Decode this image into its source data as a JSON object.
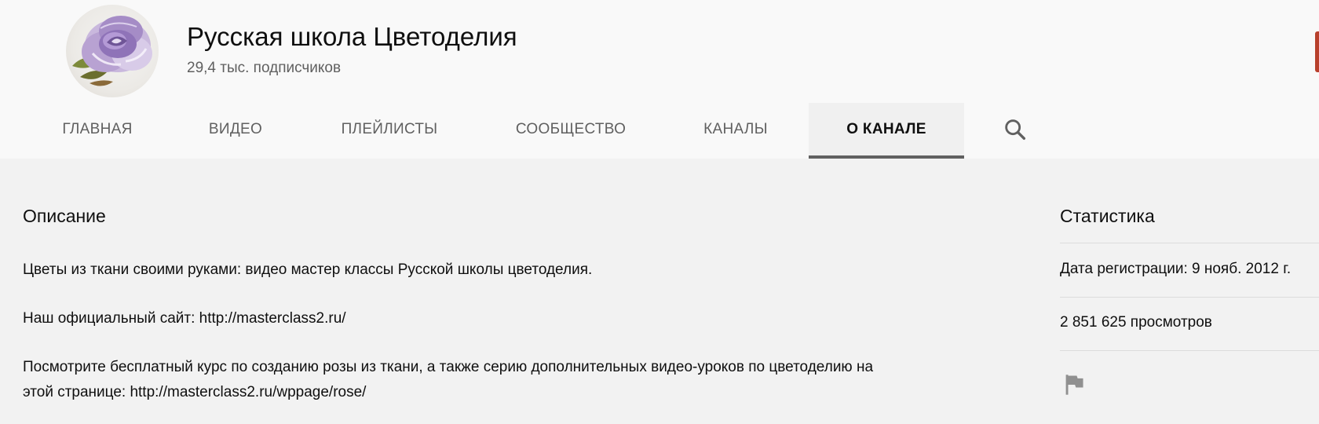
{
  "channel": {
    "title": "Русская школа Цветоделия",
    "subscribers": "29,4 тыс. подписчиков"
  },
  "tabs": [
    {
      "label": "ГЛАВНАЯ",
      "active": false
    },
    {
      "label": "ВИДЕО",
      "active": false
    },
    {
      "label": "ПЛЕЙЛИСТЫ",
      "active": false
    },
    {
      "label": "СООБЩЕСТВО",
      "active": false
    },
    {
      "label": "КАНАЛЫ",
      "active": false
    },
    {
      "label": "О КАНАЛЕ",
      "active": true
    }
  ],
  "icons": {
    "search": "search-icon",
    "flag": "flag-icon",
    "avatar": "rose-avatar"
  },
  "description": {
    "heading": "Описание",
    "paragraphs": [
      "Цветы из ткани своими руками: видео мастер классы Русской школы цветоделия.",
      "Наш официальный сайт: http://masterclass2.ru/",
      "Посмотрите бесплатный курс по созданию розы из ткани, а также серию дополнительных видео-уроков по цветоделию на этой странице: http://masterclass2.ru/wppage/rose/"
    ]
  },
  "stats": {
    "heading": "Статистика",
    "registration": "Дата регистрации: 9 нояб. 2012 г.",
    "views": "2 851 625 просмотров"
  },
  "colors": {
    "header_bg": "#f9f9f9",
    "page_bg": "#f2f2f2",
    "text": "#0f0f0f",
    "secondary_text": "#606060",
    "active_tab_underline": "#606060",
    "subscribe_edge": "#b8402c"
  }
}
